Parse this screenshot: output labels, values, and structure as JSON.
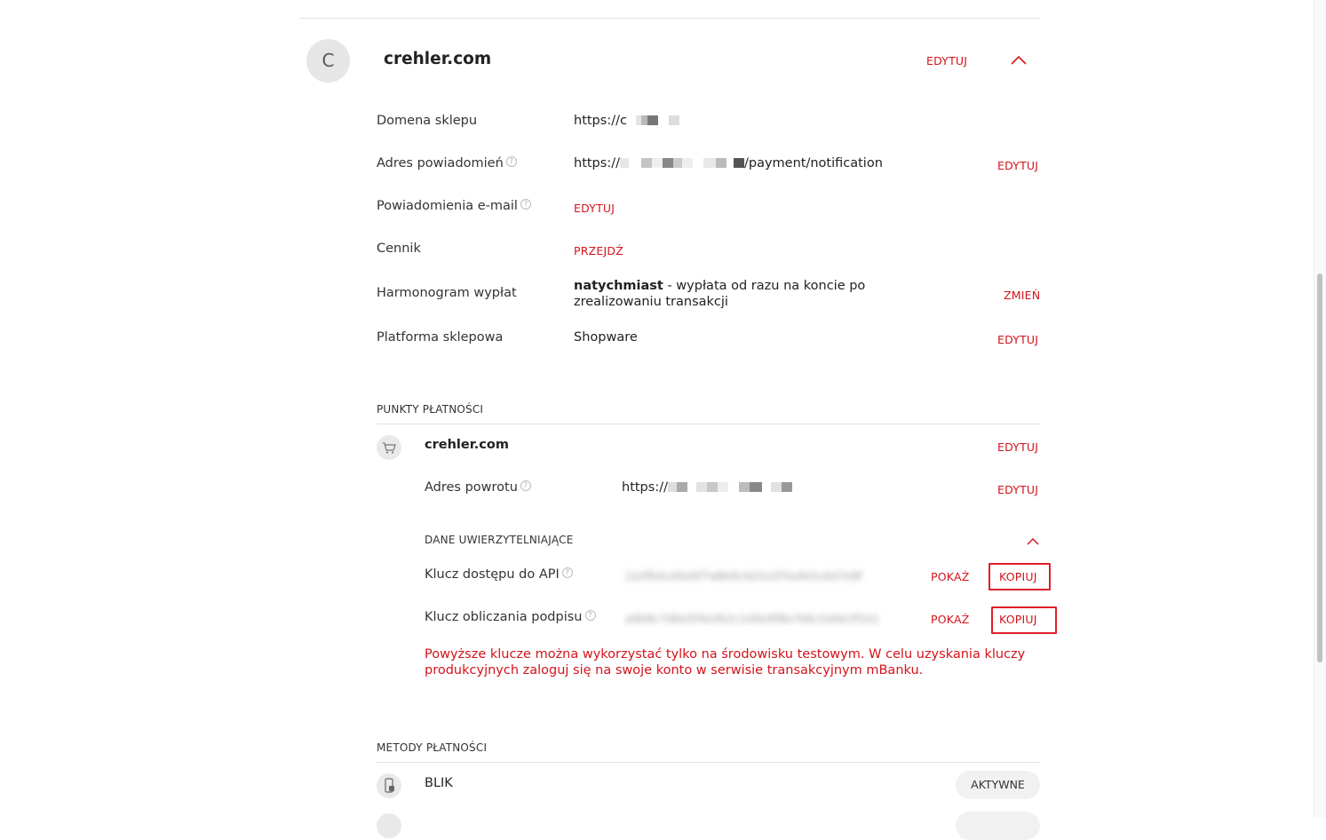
{
  "shop": {
    "avatar_letter": "C",
    "name": "crehler.com",
    "edit": "EDYTUJ"
  },
  "details": [
    {
      "label": "Domena sklepu",
      "value": "https://c",
      "help": false,
      "action": ""
    },
    {
      "label": "Adres powiadomień",
      "value_prefix": "https://",
      "value_suffix": "/payment/notification",
      "help": true,
      "action": "EDYTUJ"
    },
    {
      "label": "Powiadomienia e-mail",
      "value_link": "EDYTUJ",
      "help": true,
      "action": ""
    },
    {
      "label": "Cennik",
      "value_link": "PRZEJDŹ",
      "help": false,
      "action": ""
    },
    {
      "label": "Harmonogram wypłat",
      "value_bold": "natychmiast",
      "value_rest": " - wypłata od razu na koncie po zrealizowaniu transakcji",
      "help": false,
      "action": "ZMIEŃ"
    },
    {
      "label": "Platforma sklepowa",
      "value": "Shopware",
      "help": false,
      "action": "EDYTUJ"
    }
  ],
  "payment_points": {
    "heading": "PUNKTY PŁATNOŚCI",
    "point_name": "crehler.com",
    "edit": "EDYTUJ",
    "return_label": "Adres powrotu",
    "return_value": "https://",
    "return_edit": "EDYTUJ",
    "credentials": {
      "heading": "DANE UWIERZYTELNIAJĄCE",
      "api_key_label": "Klucz dostępu do API",
      "api_key_value": "2a3fb4cd5e6f7a8b9c0d1e2f3a4b5c6d7e8f",
      "signature_key_label": "Klucz obliczania podpisu",
      "signature_key_value": "a9b8c7d6e5f4a3b2c1d0e9f8a7b6c5d4e3f2a1",
      "show": "POKAŻ",
      "copy": "KOPIUJ",
      "warning": "Powyższe klucze można wykorzystać tylko na środowisku testowym. W celu uzyskania kluczy produkcyjnych zaloguj się na swoje konto w serwisie transakcyjnym mBanku."
    }
  },
  "payment_methods": {
    "heading": "METODY PŁATNOŚCI",
    "items": [
      {
        "name": "BLIK",
        "status": "AKTYWNE"
      }
    ]
  },
  "colors": {
    "accent": "#d4131b",
    "highlight_box": "#e0202a"
  }
}
